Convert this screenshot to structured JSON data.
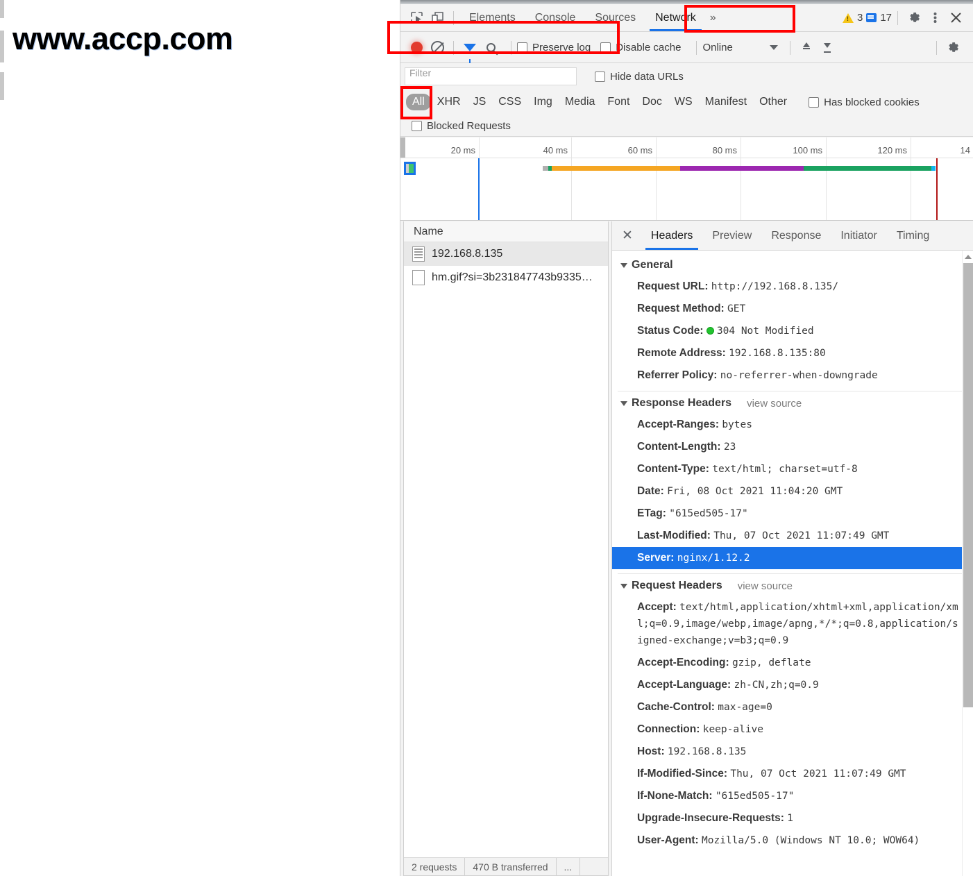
{
  "watermark": "www.accp.com",
  "devtools": {
    "main_tabs": [
      {
        "label": "Elements",
        "active": false
      },
      {
        "label": "Console",
        "active": false
      },
      {
        "label": "Sources",
        "active": false
      },
      {
        "label": "Network",
        "active": true
      }
    ],
    "more_tabs_chevron": "»",
    "warning_count": "3",
    "message_count": "17",
    "icons": {
      "inspect": "inspect-element-icon",
      "device": "device-toolbar-icon",
      "settings": "gear-icon",
      "more": "kebab-menu-icon",
      "close": "close-icon"
    }
  },
  "network_toolbar": {
    "record_label": "record-button",
    "clear_label": "clear-button",
    "filter_toggle_label": "filter-toggle",
    "search_label": "search-button",
    "preserve_log": "Preserve log",
    "preserve_log_checked": false,
    "disable_cache": "Disable cache",
    "disable_cache_checked": false,
    "throttling": "Online",
    "import_label": "import-har",
    "export_label": "export-har",
    "settings_label": "network-settings"
  },
  "filter_bar": {
    "placeholder": "Filter",
    "value": "",
    "hide_data_urls": "Hide data URLs",
    "hide_data_urls_checked": false,
    "types": [
      {
        "label": "All",
        "active": true
      },
      {
        "label": "XHR",
        "active": false
      },
      {
        "label": "JS",
        "active": false
      },
      {
        "label": "CSS",
        "active": false
      },
      {
        "label": "Img",
        "active": false
      },
      {
        "label": "Media",
        "active": false
      },
      {
        "label": "Font",
        "active": false
      },
      {
        "label": "Doc",
        "active": false
      },
      {
        "label": "WS",
        "active": false
      },
      {
        "label": "Manifest",
        "active": false
      },
      {
        "label": "Other",
        "active": false
      }
    ],
    "has_blocked_cookies": "Has blocked cookies",
    "has_blocked_cookies_checked": false,
    "blocked_requests": "Blocked Requests",
    "blocked_requests_checked": false
  },
  "overview": {
    "ticks": [
      "20 ms",
      "40 ms",
      "60 ms",
      "80 ms",
      "100 ms",
      "120 ms",
      "14"
    ],
    "dom_content_loaded_color": "#1a73e8",
    "load_event_color": "#b21818",
    "waterfall_segments": [
      {
        "name": "stalled",
        "color": "#b0b0b0"
      },
      {
        "name": "dns",
        "color": "#1aa260"
      },
      {
        "name": "ttfb",
        "color": "#f5a623"
      },
      {
        "name": "content-download",
        "color": "#9c27b0"
      },
      {
        "name": "queueing",
        "color": "#1aa260"
      },
      {
        "name": "tip",
        "color": "#12b5f0"
      }
    ]
  },
  "request_list": {
    "column_header": "Name",
    "rows": [
      {
        "name": "192.168.8.135",
        "selected": true,
        "icon": "document-icon"
      },
      {
        "name": "hm.gif?si=3b231847743b9335…",
        "selected": false,
        "icon": "blank-document-icon"
      }
    ],
    "status_bar": [
      "2 requests",
      "470 B transferred",
      "..."
    ]
  },
  "details": {
    "tabs": [
      {
        "label": "Headers",
        "active": true
      },
      {
        "label": "Preview",
        "active": false
      },
      {
        "label": "Response",
        "active": false
      },
      {
        "label": "Initiator",
        "active": false
      },
      {
        "label": "Timing",
        "active": false
      }
    ],
    "sections": [
      {
        "title": "General",
        "view_source": "",
        "rows": [
          {
            "key": "Request URL:",
            "value": "http://192.168.8.135/",
            "selected": false
          },
          {
            "key": "Request Method:",
            "value": "GET",
            "selected": false
          },
          {
            "key": "Status Code:",
            "value": "304 Not Modified",
            "status_dot": true,
            "selected": false
          },
          {
            "key": "Remote Address:",
            "value": "192.168.8.135:80",
            "selected": false
          },
          {
            "key": "Referrer Policy:",
            "value": "no-referrer-when-downgrade",
            "selected": false
          }
        ]
      },
      {
        "title": "Response Headers",
        "view_source": "view source",
        "rows": [
          {
            "key": "Accept-Ranges:",
            "value": "bytes",
            "selected": false
          },
          {
            "key": "Content-Length:",
            "value": "23",
            "selected": false
          },
          {
            "key": "Content-Type:",
            "value": "text/html; charset=utf-8",
            "selected": false
          },
          {
            "key": "Date:",
            "value": "Fri, 08 Oct 2021 11:04:20 GMT",
            "selected": false
          },
          {
            "key": "ETag:",
            "value": "\"615ed505-17\"",
            "selected": false
          },
          {
            "key": "Last-Modified:",
            "value": "Thu, 07 Oct 2021 11:07:49 GMT",
            "selected": false
          },
          {
            "key": "Server:",
            "value": "nginx/1.12.2",
            "selected": true
          }
        ]
      },
      {
        "title": "Request Headers",
        "view_source": "view source",
        "rows": [
          {
            "key": "Accept:",
            "value": "text/html,application/xhtml+xml,application/xml;q=0.9,image/webp,image/apng,*/*;q=0.8,application/signed-exchange;v=b3;q=0.9",
            "selected": false
          },
          {
            "key": "Accept-Encoding:",
            "value": "gzip, deflate",
            "selected": false
          },
          {
            "key": "Accept-Language:",
            "value": "zh-CN,zh;q=0.9",
            "selected": false
          },
          {
            "key": "Cache-Control:",
            "value": "max-age=0",
            "selected": false
          },
          {
            "key": "Connection:",
            "value": "keep-alive",
            "selected": false
          },
          {
            "key": "Host:",
            "value": "192.168.8.135",
            "selected": false
          },
          {
            "key": "If-Modified-Since:",
            "value": "Thu, 07 Oct 2021 11:07:49 GMT",
            "selected": false
          },
          {
            "key": "If-None-Match:",
            "value": "\"615ed505-17\"",
            "selected": false
          },
          {
            "key": "Upgrade-Insecure-Requests:",
            "value": "1",
            "selected": false
          },
          {
            "key": "User-Agent:",
            "value": "Mozilla/5.0 (Windows NT 10.0; WOW64)",
            "selected": false
          }
        ]
      }
    ]
  },
  "annotations": {
    "color": "#ff0000",
    "boxes": [
      "network-tab-highlight",
      "all-filter-highlight",
      "selected-request-highlight"
    ]
  }
}
